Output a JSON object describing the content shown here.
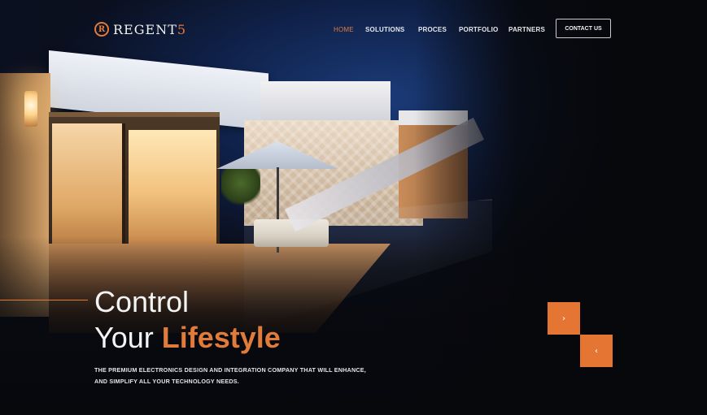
{
  "brand": {
    "logo_mark": "R",
    "name_main": "REGENT",
    "name_suffix": "5",
    "accent_color": "#e07b39"
  },
  "nav": {
    "items": [
      {
        "label": "HOME",
        "active": true
      },
      {
        "label": "SOLUTIONS",
        "active": false
      },
      {
        "label": "PROCES",
        "active": false
      },
      {
        "label": "PORTFOLIO",
        "active": false
      },
      {
        "label": "PARTNERS",
        "active": false
      }
    ],
    "contact_label": "CONTACT US"
  },
  "hero": {
    "headline_line1": "Control",
    "headline_line2_prefix": "Your",
    "headline_line2_accent": "Lifestyle",
    "subtext_line1": "THE PREMIUM ELECTRONICS DESIGN AND INTEGRATION  COMPANY THAT WILL ENHANCE,",
    "subtext_line2": "AND SIMPLIFY ALL YOUR  TECHNOLOGY NEEDS."
  },
  "slider": {
    "next_icon": "›",
    "prev_icon": "‹",
    "button_color": "#e57533"
  }
}
